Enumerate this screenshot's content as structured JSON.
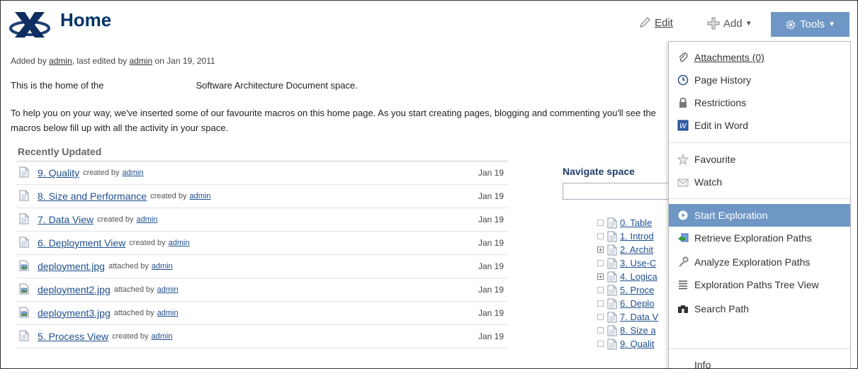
{
  "page": {
    "title": "Home",
    "meta": {
      "prefix": "Added by ",
      "author": "admin",
      "mid": ", last edited by ",
      "editor": "admin",
      "suffix": " on Jan 19, 2011"
    },
    "intro_a": "This is the home of the",
    "intro_b": "Software Architecture Document space.",
    "intro_2": "To help you on your way, we've inserted some of our favourite macros on this home page. As you start creating pages, blogging and commenting you'll see the macros below fill up with all the activity in your space."
  },
  "toolbar": {
    "edit_label": "Edit",
    "add_label": "Add",
    "tools_label": "Tools"
  },
  "recently_updated": {
    "title": "Recently Updated",
    "rows": [
      {
        "name": "9. Quality",
        "verb": "created by",
        "user": "admin",
        "date": "Jan 19",
        "icon": "page-icon"
      },
      {
        "name": "8. Size and Performance",
        "verb": "created by",
        "user": "admin",
        "date": "Jan 19",
        "icon": "page-icon"
      },
      {
        "name": "7. Data View",
        "verb": "created by",
        "user": "admin",
        "date": "Jan 19",
        "icon": "page-icon"
      },
      {
        "name": "6. Deployment View",
        "verb": "created by",
        "user": "admin",
        "date": "Jan 19",
        "icon": "page-icon"
      },
      {
        "name": "deployment.jpg",
        "verb": "attached by",
        "user": "admin",
        "date": "Jan 19",
        "icon": "image-icon"
      },
      {
        "name": "deployment2.jpg",
        "verb": "attached by",
        "user": "admin",
        "date": "Jan 19",
        "icon": "image-icon"
      },
      {
        "name": "deployment3.jpg",
        "verb": "attached by",
        "user": "admin",
        "date": "Jan 19",
        "icon": "image-icon"
      },
      {
        "name": "5. Process View",
        "verb": "created by",
        "user": "admin",
        "date": "Jan 19",
        "icon": "page-icon"
      }
    ]
  },
  "navigate": {
    "title": "Navigate space",
    "tree": [
      {
        "label": "0. Table",
        "expandable": false
      },
      {
        "label": "1. Introd",
        "expandable": false
      },
      {
        "label": "2. Archit",
        "expandable": true
      },
      {
        "label": "3. Use-C",
        "expandable": false
      },
      {
        "label": "4. Logica",
        "expandable": true
      },
      {
        "label": "5. Proce",
        "expandable": false
      },
      {
        "label": "6. Deplo",
        "expandable": false
      },
      {
        "label": "7. Data V",
        "expandable": false
      },
      {
        "label": "8. Size a",
        "expandable": false
      },
      {
        "label": "9. Qualit",
        "expandable": false
      }
    ]
  },
  "tools_menu": {
    "items": [
      {
        "label": "Attachments (0)",
        "icon": "paperclip-icon"
      },
      {
        "label": "Page History",
        "icon": "history-icon"
      },
      {
        "label": "Restrictions",
        "icon": "lock-icon"
      },
      {
        "label": "Edit in Word",
        "icon": "word-icon"
      },
      {
        "label": "Favourite",
        "icon": "star-icon"
      },
      {
        "label": "Watch",
        "icon": "envelope-icon"
      },
      {
        "label": "Start Exploration",
        "icon": "play-icon"
      },
      {
        "label": "Retrieve Exploration Paths",
        "icon": "retrieve-icon"
      },
      {
        "label": "Analyze Exploration Paths",
        "icon": "wrench-icon"
      },
      {
        "label": "Exploration Paths Tree View",
        "icon": "list-icon"
      },
      {
        "label": "Search Path",
        "icon": "binoculars-icon"
      },
      {
        "label": "Info",
        "icon": "info-icon"
      }
    ]
  },
  "colors": {
    "accent": "#6f97c5",
    "link": "#1f4f8f",
    "title": "#003366"
  }
}
